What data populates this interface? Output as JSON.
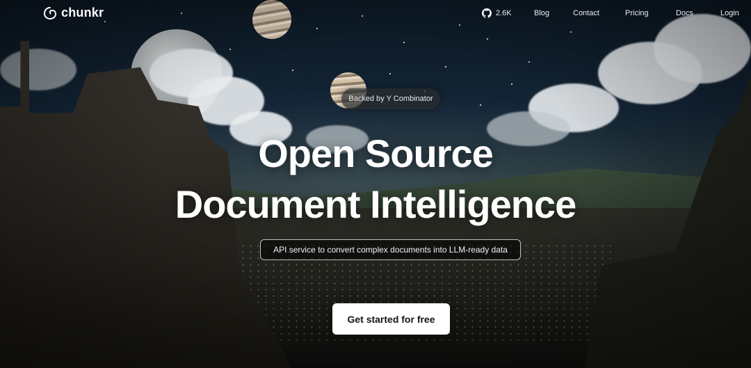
{
  "brand": {
    "name": "chunkr",
    "logo_icon": "chunkr-swirl-icon"
  },
  "nav": {
    "github": {
      "icon": "github-icon",
      "stars": "2.6K"
    },
    "links": [
      "Blog",
      "Contact",
      "Pricing",
      "Docs",
      "Login"
    ]
  },
  "hero": {
    "badge": "Backed by Y Combinator",
    "headline_line1": "Open Source",
    "headline_line2": "Document Intelligence",
    "subheadline": "API service to convert complex documents into LLM-ready data",
    "cta_label": "Get started for free"
  },
  "colors": {
    "cta_bg": "#ffffff",
    "cta_text": "#111418",
    "text": "#ffffff"
  }
}
